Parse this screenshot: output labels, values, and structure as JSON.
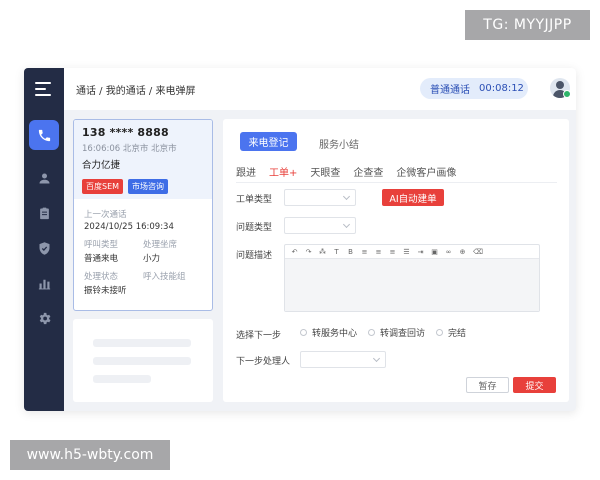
{
  "watermarks": {
    "top": "TG: MYYJJPP",
    "bottom": "www.h5-wbty.com"
  },
  "sidebar": {
    "items": [
      {
        "icon": "phone-icon",
        "active": true
      },
      {
        "icon": "user-icon",
        "active": false
      },
      {
        "icon": "clipboard-icon",
        "active": false
      },
      {
        "icon": "shield-icon",
        "active": false
      },
      {
        "icon": "bar-chart-icon",
        "active": false
      },
      {
        "icon": "gear-icon",
        "active": false
      }
    ]
  },
  "header": {
    "breadcrumb": "通话 / 我的通话 / 来电弹屏",
    "call_type": "普通通话",
    "call_timer": "00:08:12"
  },
  "caller": {
    "phone": "138 **** 8888",
    "time": "16:06:06",
    "location": "北京市 北京市",
    "company": "合力亿捷",
    "tags": [
      "百度SEM",
      "市场咨询"
    ],
    "last_call_label": "上一次通话",
    "last_call_value": "2024/10/25  16:09:34",
    "call_type_label": "呼叫类型",
    "call_type_value": "普通来电",
    "agent_label": "处理坐席",
    "agent_value": "小力",
    "status_label": "处理状态",
    "status_value": "振铃未接听",
    "skill_group_label": "呼入技能组",
    "skill_group_value": ""
  },
  "main": {
    "tabs": [
      {
        "label": "来电登记",
        "active": true
      },
      {
        "label": "服务小结",
        "active": false
      }
    ],
    "subtabs": [
      {
        "label": "跟进",
        "active": false
      },
      {
        "label": "工单+",
        "active": true
      },
      {
        "label": "天眼查",
        "active": false
      },
      {
        "label": "企查查",
        "active": false
      },
      {
        "label": "企微客户画像",
        "active": false
      }
    ],
    "form": {
      "ticket_type_label": "工单类型",
      "ticket_type_value": "",
      "issue_type_label": "问题类型",
      "issue_type_value": "",
      "issue_desc_label": "问题描述",
      "ai_button": "AI自动建单",
      "next_step_label": "选择下一步",
      "next_step_options": [
        "转服务中心",
        "转调查回访",
        "完结"
      ],
      "next_handler_label": "下一步处理人",
      "next_handler_value": "",
      "save_label": "暂存",
      "submit_label": "提交"
    }
  },
  "colors": {
    "sidebar_bg": "#232c45",
    "accent_blue": "#4b74ef",
    "accent_red": "#e8403b",
    "pill_bg": "#e3ecfb"
  }
}
